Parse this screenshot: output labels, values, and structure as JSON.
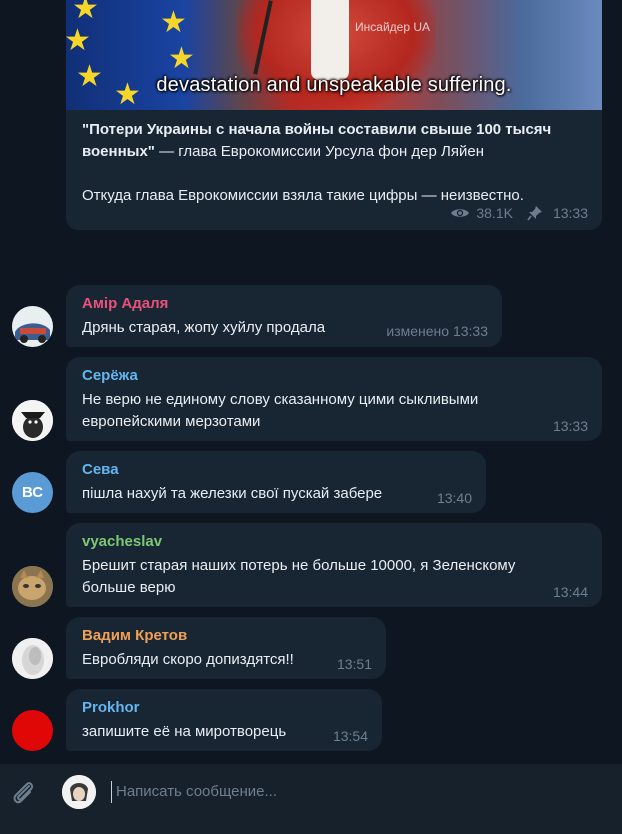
{
  "post": {
    "caption": "devastation and unspeakable suffering.",
    "watermark": "Инсайдер UA",
    "title_bold": "\"Потери Украины с начала войны составили свыше 100 тысяч военных\"",
    "title_rest": " — глава Еврокомиссии Урсула фон дер Ляйен",
    "body": "Откуда глава Еврокомиссии взяла такие цифры — неизвестно.",
    "views": "38.1K",
    "time": "13:33"
  },
  "messages": [
    {
      "name": "Амір Адаля",
      "name_color": "#e9517b",
      "text": "Дрянь старая, жопу хуйлу продала",
      "time": "изменено 13:33"
    },
    {
      "name": "Серёжа",
      "name_color": "#64b5ef",
      "text": "Не верю не единому слову сказанному цими сыкливыми европейскими мерзотами",
      "time": "13:33"
    },
    {
      "name": "Сева",
      "name_color": "#64b5ef",
      "text": "пішла нахуй та железки свої пускай забере",
      "time": "13:40",
      "avatar_initials": "ВС",
      "avatar_color": "#5b9bd5"
    },
    {
      "name": "vyacheslav",
      "name_color": "#7ec874",
      "text": "Брешит старая наших потерь не больше 10000, я Зеленскому больше верю",
      "time": "13:44"
    },
    {
      "name": "Вадим Кретов",
      "name_color": "#f0a056",
      "text": "Евробляди скоро допиздятся!!",
      "time": "13:51"
    },
    {
      "name": "Prokhor",
      "name_color": "#64b5ef",
      "text": "запишите её на миротворець",
      "time": "13:54"
    }
  ],
  "composer": {
    "placeholder": "Написать сообщение..."
  },
  "icons": {
    "views": "eye-icon",
    "pin": "pin-icon",
    "attach": "paperclip-icon"
  }
}
